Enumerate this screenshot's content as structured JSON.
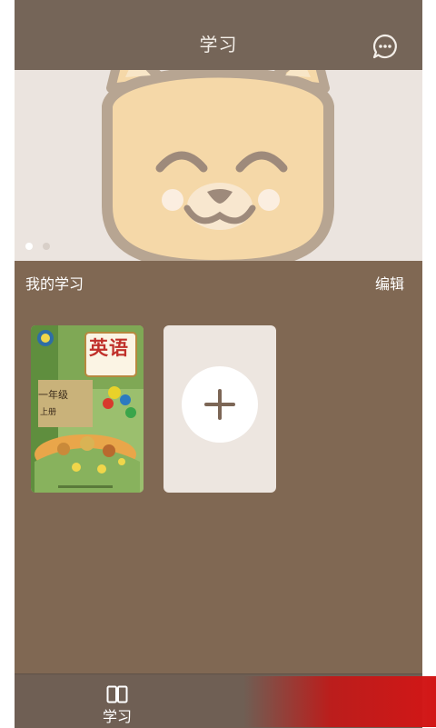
{
  "header": {
    "title": "学习",
    "chat_icon": "chat-bubble-icon"
  },
  "banner": {
    "image": "cartoon-cat-face",
    "pagination": {
      "count": 2,
      "active_index": 0
    }
  },
  "my_study": {
    "title": "我的学习",
    "edit_label": "编辑",
    "books": [
      {
        "title": "英语",
        "grade": "一年级",
        "volume": "上册"
      }
    ],
    "add_icon": "plus-icon"
  },
  "bottom_nav": {
    "tabs": [
      {
        "label": "学习",
        "icon": "book-icon",
        "active": true
      }
    ]
  },
  "colors": {
    "background": "#806853",
    "header": "#756558",
    "banner": "#ebe4df",
    "card": "#ede6e0",
    "bottom_bar": "#6f5f54"
  }
}
